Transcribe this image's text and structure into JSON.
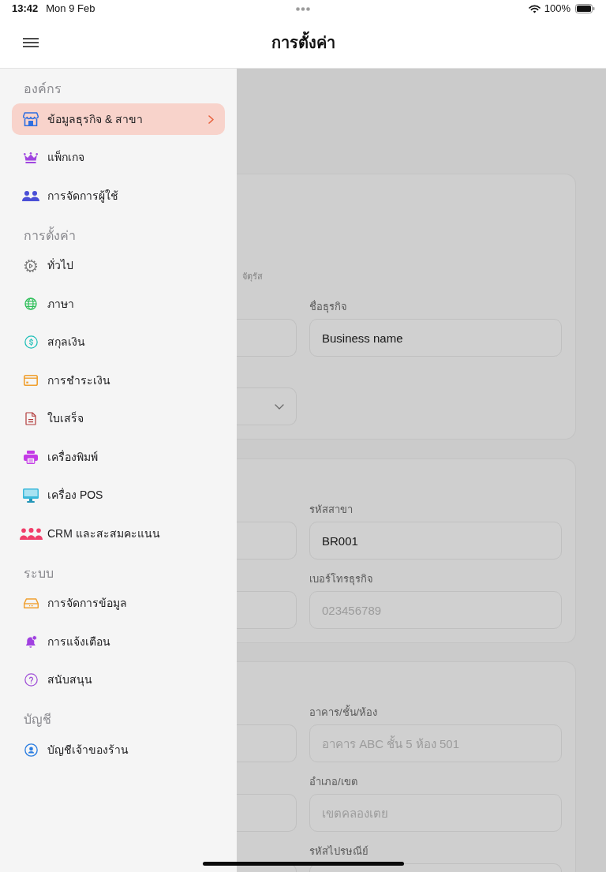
{
  "status_bar": {
    "time": "13:42",
    "date": "Mon 9 Feb",
    "battery_text": "100%"
  },
  "header": {
    "title": "การตั้งค่า"
  },
  "sidebar": {
    "sections": [
      {
        "title": "องค์กร",
        "items": [
          {
            "label": "ข้อมูลธุรกิจ & สาขา",
            "selected": true
          },
          {
            "label": "แพ็กเกจ",
            "selected": false
          },
          {
            "label": "การจัดการผู้ใช้",
            "selected": false
          }
        ]
      },
      {
        "title": "การตั้งค่า",
        "items": [
          {
            "label": "ทั่วไป",
            "selected": false
          },
          {
            "label": "ภาษา",
            "selected": false
          },
          {
            "label": "สกุลเงิน",
            "selected": false
          },
          {
            "label": "การชำระเงิน",
            "selected": false
          },
          {
            "label": "ใบเสร็จ",
            "selected": false
          },
          {
            "label": "เครื่องพิมพ์",
            "selected": false
          },
          {
            "label": "เครื่อง POS",
            "selected": false
          },
          {
            "label": "CRM และสะสมคะแนน",
            "selected": false
          }
        ]
      },
      {
        "title": "ระบบ",
        "items": [
          {
            "label": "การจัดการข้อมูล",
            "selected": false
          },
          {
            "label": "การแจ้งเตือน",
            "selected": false
          },
          {
            "label": "สนับสนุน",
            "selected": false
          }
        ]
      },
      {
        "title": "บัญชี",
        "items": [
          {
            "label": "บัญชีเจ้าของร้าน",
            "selected": false
          }
        ]
      }
    ]
  },
  "form": {
    "cards": [
      {
        "rows": [
          {
            "kind": "hint",
            "text": "จัตุรัส"
          },
          {
            "kind": "field",
            "label": "ชื่อธุรกิจ",
            "value": "Business name"
          },
          {
            "kind": "select"
          }
        ]
      },
      {
        "rows": [
          {
            "kind": "field",
            "label": "รหัสสาขา",
            "value": "BR001"
          },
          {
            "kind": "field",
            "label": "เบอร์โทรธุรกิจ",
            "placeholder": "023456789"
          }
        ]
      },
      {
        "rows": [
          {
            "kind": "field",
            "label": "อาคาร/ชั้น/ห้อง",
            "placeholder": "อาคาร ABC ชั้น 5 ห้อง 501"
          },
          {
            "kind": "field",
            "label": "อำเภอ/เขต",
            "placeholder": "เขตคลองเตย"
          },
          {
            "kind": "field",
            "label": "รหัสไปรษณีย์"
          }
        ]
      }
    ]
  }
}
